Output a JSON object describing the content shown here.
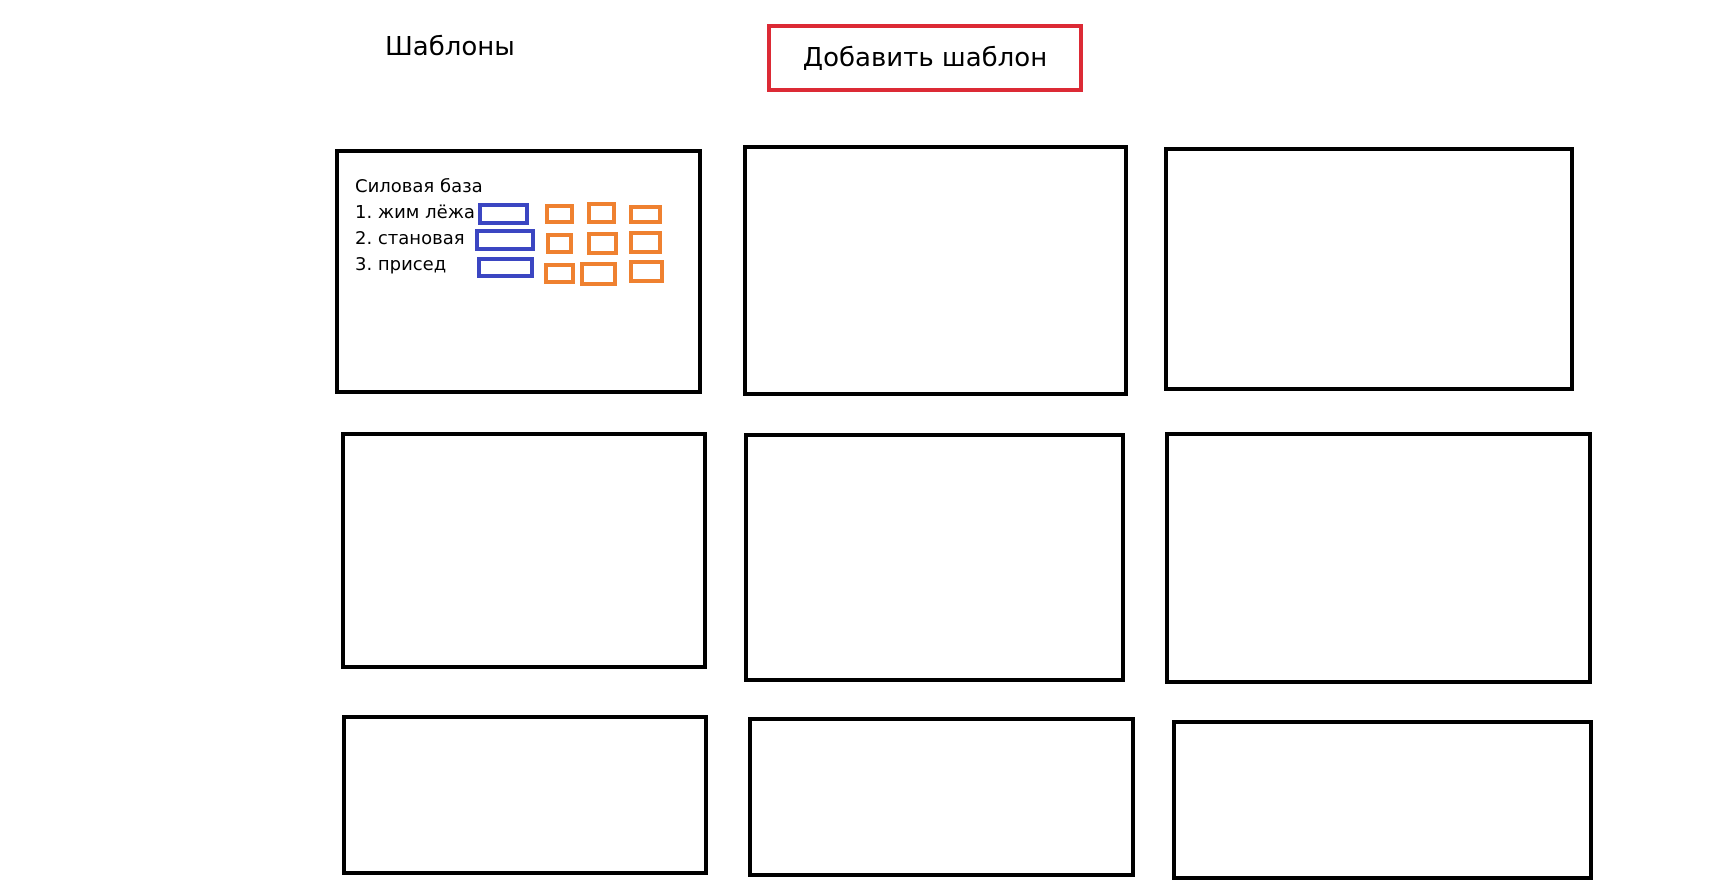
{
  "header": {
    "title": "Шаблоны",
    "add_button_label": "Добавить шаблон"
  },
  "colors": {
    "add_button_border": "#dc2a35",
    "set_input_border": "#3b46c2",
    "rep_input_border": "#ef8130"
  },
  "template_card": {
    "title": "Силовая база",
    "exercises": [
      {
        "label": "1. жим лёжа"
      },
      {
        "label": "2. становая"
      },
      {
        "label": "3. присед"
      }
    ]
  },
  "empty_card_count": 8
}
